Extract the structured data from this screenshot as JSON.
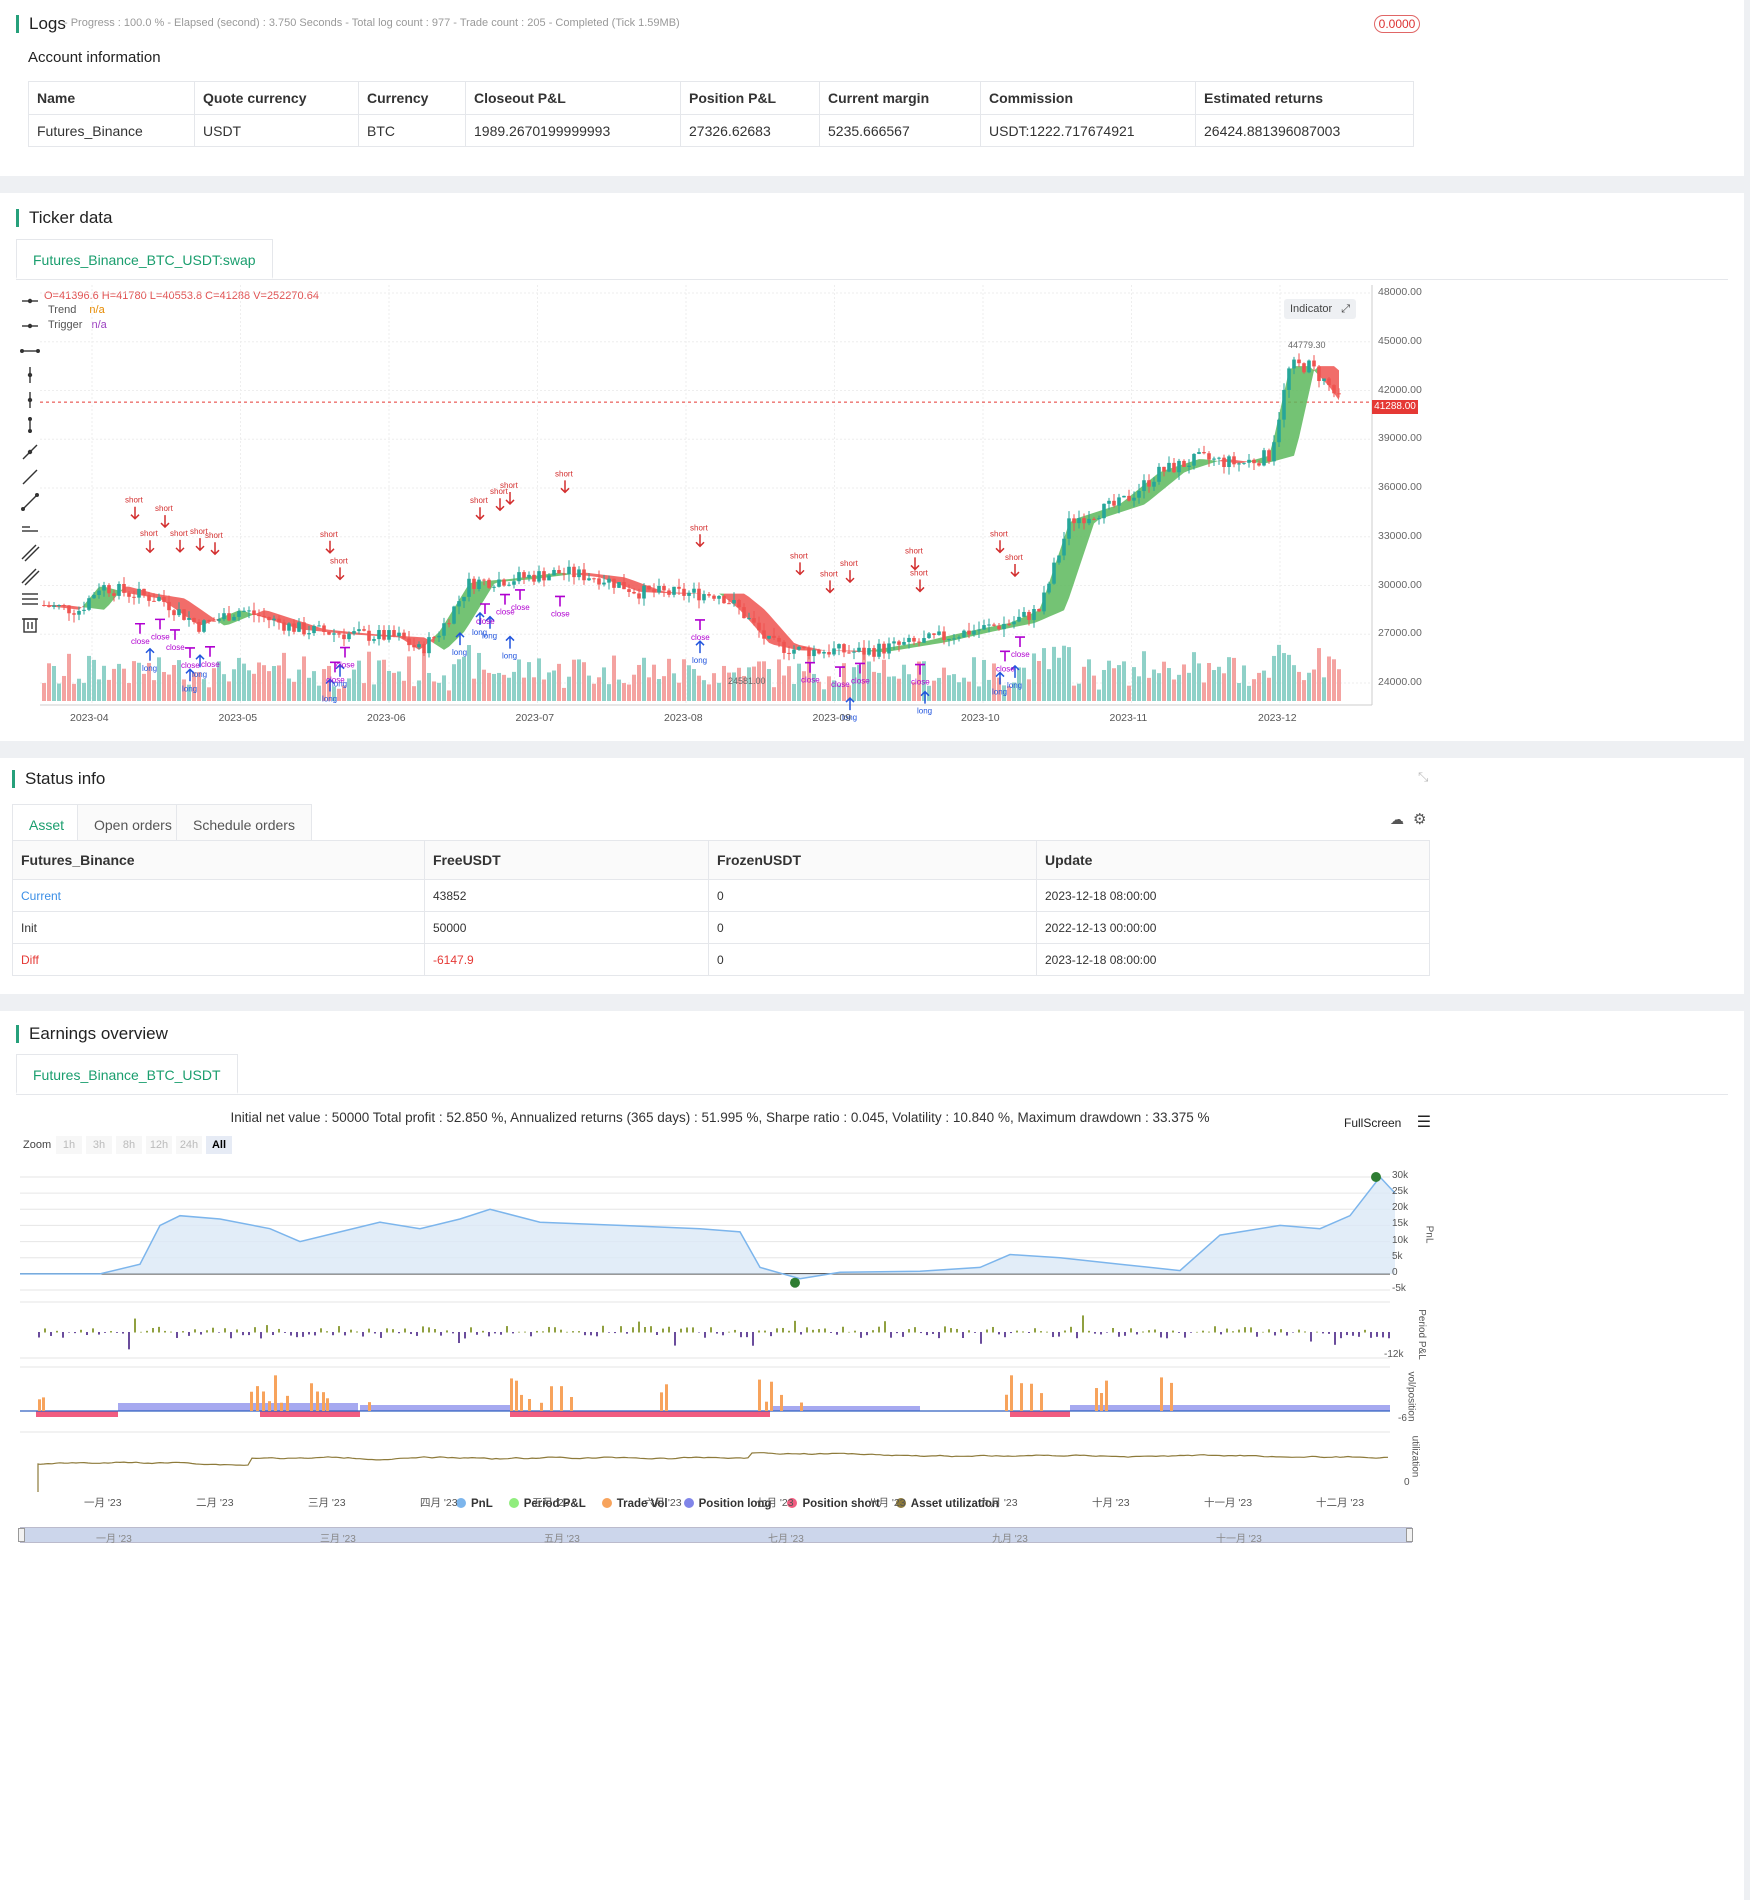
{
  "logs": {
    "title": "Logs",
    "status": "- Progress : 100.0 % - Elapsed (second) : 3.750  Seconds - Total log count : 977 - Trade count : 205 - Completed (Tick 1.59MB)",
    "badge": "0.0000",
    "account_title": "Account information",
    "headers": [
      "Name",
      "Quote currency",
      "Currency",
      "Closeout P&L",
      "Position P&L",
      "Current margin",
      "Commission",
      "Estimated returns"
    ],
    "row": [
      "Futures_Binance",
      "USDT",
      "BTC",
      "1989.2670199999993",
      "27326.62683",
      "5235.666567",
      "USDT:1222.717674921",
      "26424.881396087003"
    ]
  },
  "ticker": {
    "title": "Ticker data",
    "tab": "Futures_Binance_BTC_USDT:swap",
    "ohlc": "O=41396.6 H=41780 L=40553.8 C=41288 V=252270.64",
    "legend_trend": "Trend",
    "legend_trend_val": "n/a",
    "legend_trigger": "Trigger",
    "legend_trigger_val": "n/a",
    "indicator_btn": "Indicator",
    "price_labels": [
      "48000.00",
      "45000.00",
      "42000.00",
      "39000.00",
      "36000.00",
      "33000.00",
      "30000.00",
      "27000.00",
      "24000.00"
    ],
    "last_price": "41288.00",
    "high_label": "44779.30",
    "low_label": "24581.00",
    "x_labels": [
      "2023-04",
      "2023-05",
      "2023-06",
      "2023-07",
      "2023-08",
      "2023-09",
      "2023-10",
      "2023-11",
      "2023-12"
    ]
  },
  "status": {
    "title": "Status info",
    "tabs": [
      "Asset",
      "Open orders",
      "Schedule orders"
    ],
    "headers": [
      "Futures_Binance",
      "FreeUSDT",
      "FrozenUSDT",
      "Update"
    ],
    "rows": [
      [
        "Current",
        "43852",
        "0",
        "2023-12-18 08:00:00"
      ],
      [
        "Init",
        "50000",
        "0",
        "2022-12-13 00:00:00"
      ],
      [
        "Diff",
        "-6147.9",
        "0",
        "2023-12-18 08:00:00"
      ]
    ]
  },
  "earnings": {
    "title": "Earnings overview",
    "tab": "Futures_Binance_BTC_USDT",
    "summary": "Initial net value : 50000 Total profit : 52.850 %, Annualized returns (365 days) : 51.995 %, Sharpe ratio : 0.045, Volatility : 10.840 %, Maximum drawdown : 33.375 %",
    "fullscreen": "FullScreen",
    "zoom_label": "Zoom",
    "zoom_buttons": [
      "1h",
      "3h",
      "8h",
      "12h",
      "24h",
      "All"
    ],
    "pnl_axis": [
      "30k",
      "25k",
      "20k",
      "15k",
      "10k",
      "5k",
      "0",
      "-5k"
    ],
    "pnl_axis_title": "PnL",
    "period_axis": "-12k",
    "period_axis_title": "Period P&L",
    "vol_axis": "-6",
    "vol_axis_title": "vol/position",
    "util_axis": "0",
    "util_axis_title": "utilization",
    "months": [
      "一月 '23",
      "二月 '23",
      "三月 '23",
      "四月 '23",
      "五月 '23",
      "六月 '23",
      "七月 '23",
      "八月 '23",
      "九月 '23",
      "十月 '23",
      "十一月 '23",
      "十二月 '23"
    ],
    "legend": [
      "PnL",
      "Period P&L",
      "Trade Vol",
      "Position long",
      "Position short",
      "Asset utilization"
    ],
    "legend_colors": [
      "#7cb5ec",
      "#90ed7d",
      "#f7a35c",
      "#8085e9",
      "#f15c80",
      "#8d7a3a"
    ],
    "navigator_months": [
      "一月 '23",
      "三月 '23",
      "五月 '23",
      "七月 '23",
      "九月 '23",
      "十一月 '23"
    ]
  }
}
